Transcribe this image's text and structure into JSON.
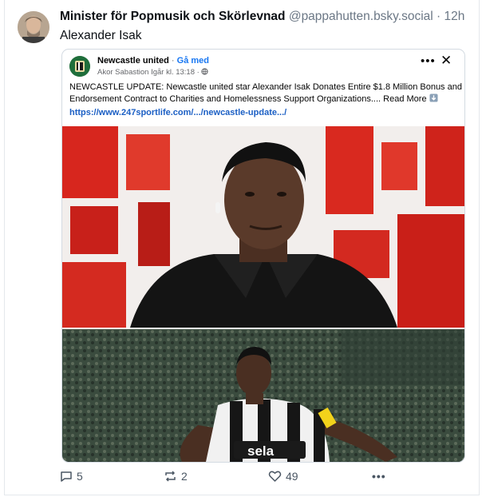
{
  "post": {
    "author_name": "Minister för Popmusik och Skörlevnad",
    "author_handle": "@pappahutten.bsky.social",
    "separator": "·",
    "time": "12h",
    "text": "Alexander Isak"
  },
  "card": {
    "page_name": "Newcastle united",
    "separator": "·",
    "join_label": "Gå med",
    "sub_author": "Akor Sabastion",
    "sub_time": "Igår kl. 13:18 ·",
    "more_label": "•••",
    "close_label": "✕",
    "body_text": "NEWCASTLE UPDATE: Newcastle united star Alexander Isak Donates Entire $1.8 Million Bonus and Endorsement Contract to Charities and Homelessness Support Organizations....",
    "read_more": "Read More",
    "link": "https://www.247sportlife.com/.../newcastle-update.../",
    "jersey_text": "sela"
  },
  "actions": {
    "replies": "5",
    "reposts": "2",
    "likes": "49",
    "more": "•••"
  },
  "colors": {
    "accent": "#1877f2",
    "link": "#1b5fc4",
    "muted": "#6b7785",
    "icon": "#4a5663"
  }
}
